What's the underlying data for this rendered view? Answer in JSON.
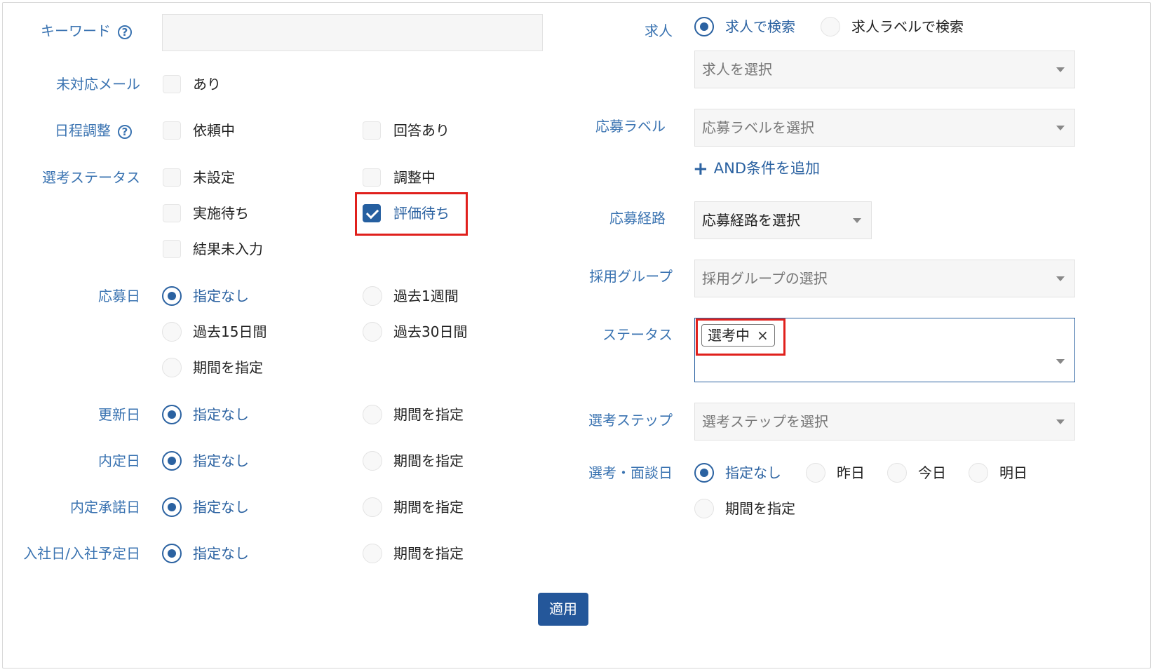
{
  "left": {
    "keyword": {
      "label": "キーワード",
      "value": ""
    },
    "unreplied_mail": {
      "label": "未対応メール",
      "option": "あり"
    },
    "schedule": {
      "label": "日程調整",
      "options": [
        "依頼中",
        "回答あり"
      ]
    },
    "selection_status": {
      "label": "選考ステータス",
      "options": [
        "未設定",
        "調整中",
        "実施待ち",
        "評価待ち",
        "結果未入力"
      ],
      "checked": "評価待ち"
    },
    "applied_date": {
      "label": "応募日",
      "options": [
        "指定なし",
        "過去1週間",
        "過去15日間",
        "過去30日間",
        "期間を指定"
      ],
      "selected": "指定なし"
    },
    "updated_date": {
      "label": "更新日",
      "options": [
        "指定なし",
        "期間を指定"
      ],
      "selected": "指定なし"
    },
    "offer_date": {
      "label": "内定日",
      "options": [
        "指定なし",
        "期間を指定"
      ],
      "selected": "指定なし"
    },
    "offer_accept_date": {
      "label": "内定承諾日",
      "options": [
        "指定なし",
        "期間を指定"
      ],
      "selected": "指定なし"
    },
    "join_date": {
      "label": "入社日/入社予定日",
      "options": [
        "指定なし",
        "期間を指定"
      ],
      "selected": "指定なし"
    }
  },
  "right": {
    "job": {
      "label": "求人",
      "options": [
        "求人で検索",
        "求人ラベルで検索"
      ],
      "selected": "求人で検索",
      "placeholder": "求人を選択"
    },
    "apply_label": {
      "label": "応募ラベル",
      "placeholder": "応募ラベルを選択",
      "add_condition": "AND条件を追加"
    },
    "route": {
      "label": "応募経路",
      "placeholder": "応募経路を選択"
    },
    "group": {
      "label": "採用グループ",
      "placeholder": "採用グループの選択"
    },
    "status": {
      "label": "ステータス",
      "tags": [
        "選考中"
      ],
      "remove_glyph": "×"
    },
    "step": {
      "label": "選考ステップ",
      "placeholder": "選考ステップを選択"
    },
    "interview_date": {
      "label": "選考・面談日",
      "options": [
        "指定なし",
        "昨日",
        "今日",
        "明日",
        "期間を指定"
      ],
      "selected": "指定なし"
    }
  },
  "apply_button": "適用",
  "colors": {
    "accent": "#2b62a1",
    "button": "#24579a",
    "highlight": "#e0201c"
  },
  "icons": {
    "help": "question-circle-icon",
    "check": "check-icon",
    "caret": "caret-down-icon",
    "plus": "plus-icon",
    "remove": "close-icon"
  }
}
